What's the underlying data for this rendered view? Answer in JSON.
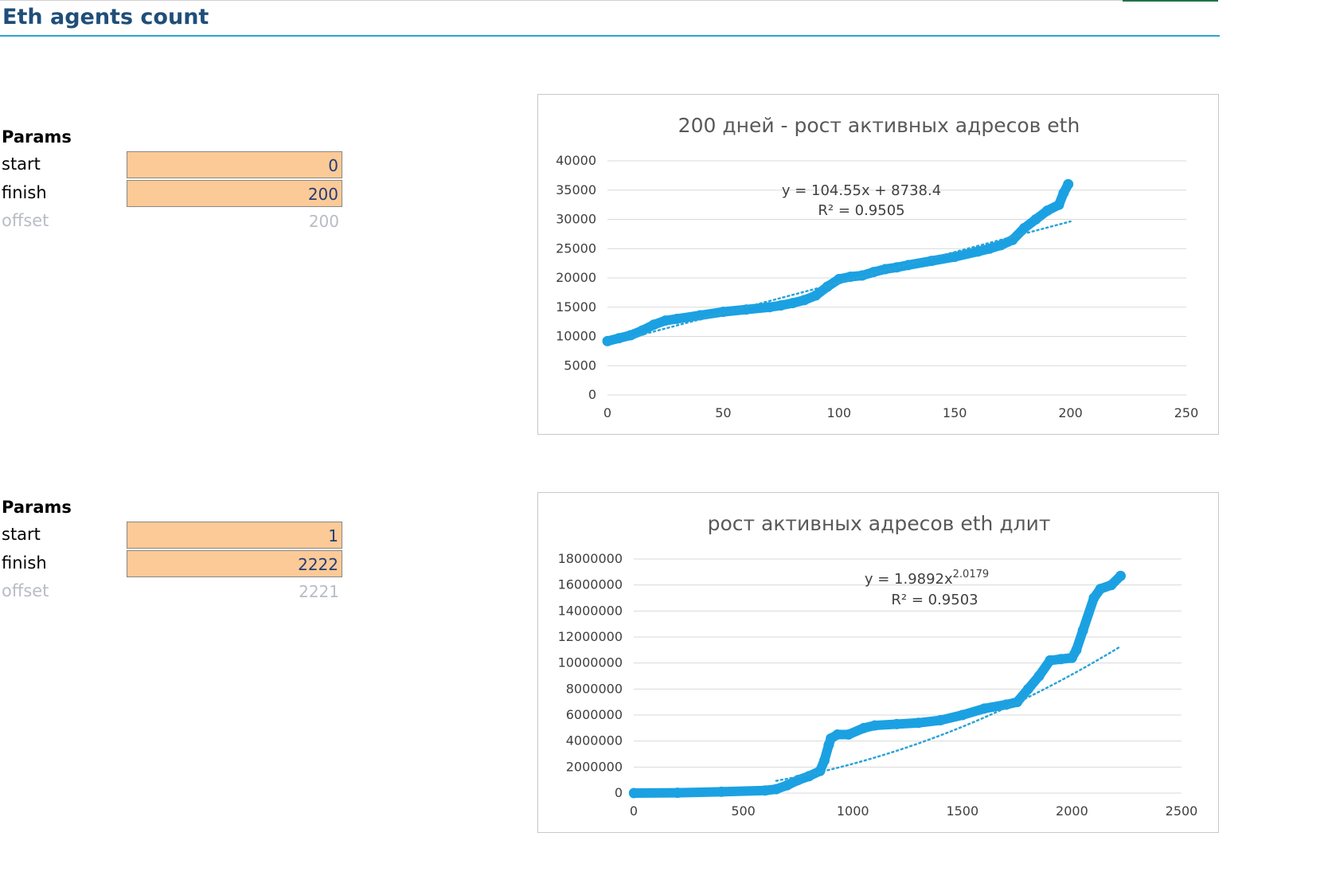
{
  "sheet": {
    "title": "Eth agents count"
  },
  "params1": {
    "header": "Params",
    "rows": [
      {
        "label": "start",
        "value": "0"
      },
      {
        "label": "finish",
        "value": "200"
      },
      {
        "label": "offset",
        "value": "200"
      }
    ]
  },
  "params2": {
    "header": "Params",
    "rows": [
      {
        "label": "start",
        "value": "1"
      },
      {
        "label": "finish",
        "value": "2222"
      },
      {
        "label": "offset",
        "value": "2221"
      }
    ]
  },
  "colors": {
    "series": "#1ba1e2",
    "trend": "#2aa3d8",
    "title_rule": "#2ea3d5",
    "input_fill": "#fcca96"
  },
  "chart_data": [
    {
      "type": "scatter",
      "title": "200 дней - рост активных адресов eth",
      "xlim": [
        0,
        250
      ],
      "ylim": [
        0,
        40000
      ],
      "xticks": [
        "0",
        "50",
        "100",
        "150",
        "200",
        "250"
      ],
      "yticks": [
        "0",
        "5000",
        "10000",
        "15000",
        "20000",
        "25000",
        "30000",
        "35000",
        "40000"
      ],
      "grid": true,
      "x": [
        0,
        5,
        10,
        15,
        20,
        25,
        30,
        40,
        50,
        60,
        70,
        75,
        80,
        85,
        90,
        95,
        100,
        105,
        110,
        115,
        120,
        125,
        130,
        140,
        150,
        160,
        165,
        170,
        175,
        180,
        185,
        190,
        195,
        197,
        199
      ],
      "y": [
        9200,
        9700,
        10200,
        11000,
        12000,
        12700,
        13000,
        13600,
        14200,
        14600,
        15000,
        15300,
        15700,
        16200,
        17000,
        18500,
        19800,
        20200,
        20400,
        21000,
        21500,
        21800,
        22200,
        22900,
        23600,
        24500,
        25000,
        25600,
        26500,
        28500,
        30000,
        31500,
        32500,
        34500,
        36000
      ],
      "trendline": {
        "type": "linear",
        "slope": 104.55,
        "intercept": 8738.4,
        "x_range": [
          10,
          200
        ]
      },
      "equation": "y = 104.55x + 8738.4",
      "r2": "R² = 0.9505"
    },
    {
      "type": "scatter",
      "title": "рост активных адресов eth длит",
      "xlim": [
        0,
        2500
      ],
      "ylim": [
        0,
        18000000
      ],
      "xticks": [
        "0",
        "500",
        "1000",
        "1500",
        "2000",
        "2500"
      ],
      "yticks": [
        "0",
        "2000000",
        "4000000",
        "6000000",
        "8000000",
        "10000000",
        "12000000",
        "14000000",
        "16000000",
        "18000000"
      ],
      "grid": true,
      "x": [
        1,
        200,
        400,
        600,
        650,
        700,
        750,
        800,
        850,
        870,
        890,
        900,
        930,
        980,
        1050,
        1100,
        1200,
        1300,
        1400,
        1500,
        1600,
        1700,
        1750,
        1800,
        1850,
        1900,
        1950,
        2000,
        2020,
        2050,
        2100,
        2130,
        2180,
        2222
      ],
      "y": [
        0,
        20000,
        100000,
        200000,
        300000,
        600000,
        1000000,
        1300000,
        1700000,
        2500000,
        3700000,
        4200000,
        4500000,
        4500000,
        5000000,
        5200000,
        5300000,
        5400000,
        5600000,
        6000000,
        6500000,
        6800000,
        7000000,
        8000000,
        9000000,
        10200000,
        10300000,
        10400000,
        11000000,
        12500000,
        15000000,
        15700000,
        16000000,
        16700000
      ],
      "trendline": {
        "type": "power",
        "coef": 1.9892,
        "exp": 2.0179,
        "x_range": [
          650,
          2222
        ]
      },
      "equation": "y = 1.9892x",
      "equation_exp": "2.0179",
      "r2": "R² = 0.9503"
    }
  ]
}
